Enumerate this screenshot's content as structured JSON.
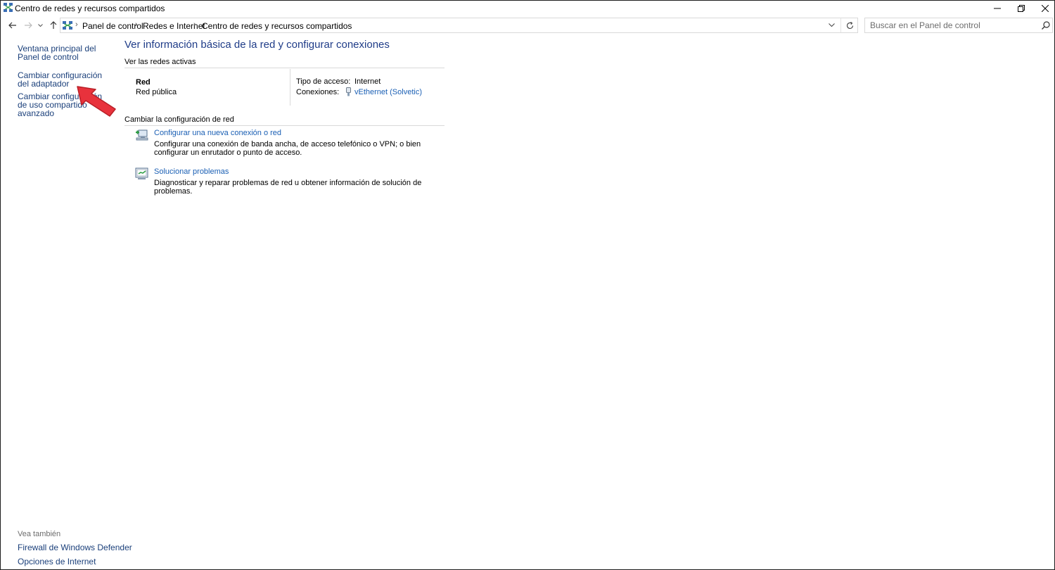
{
  "window": {
    "title": "Centro de redes y recursos compartidos",
    "icons": {
      "app": "network-center-icon",
      "minimize": "minimize-icon",
      "maximize": "restore-icon",
      "close": "close-icon"
    }
  },
  "navigation": {
    "breadcrumb": [
      "Panel de control",
      "Redes e Internet",
      "Centro de redes y recursos compartidos"
    ],
    "search_placeholder": "Buscar en el Panel de control"
  },
  "sidebar": {
    "links": [
      {
        "label": "Ventana principal del Panel de control"
      },
      {
        "label": "Cambiar configuración del adaptador"
      },
      {
        "label": "Cambiar configuración de uso compartido avanzado"
      }
    ],
    "see_also_label": "Vea también",
    "see_also_links": [
      {
        "label": "Firewall de Windows Defender"
      },
      {
        "label": "Opciones de Internet"
      }
    ]
  },
  "main": {
    "title": "Ver información básica de la red y configurar conexiones",
    "active_networks_heading": "Ver las redes activas",
    "network": {
      "name": "Red",
      "type": "Red pública",
      "access_type_label": "Tipo de acceso:",
      "access_type_value": "Internet",
      "connections_label": "Conexiones:",
      "connection_name": "vEthernet (Solvetic)"
    },
    "change_settings_heading": "Cambiar la configuración de red",
    "tasks": [
      {
        "link": "Configurar una nueva conexión o red",
        "description": "Configurar una conexión de banda ancha, de acceso telefónico o VPN; o bien configurar un enrutador o punto de acceso.",
        "icon": "new-connection-icon"
      },
      {
        "link": "Solucionar problemas",
        "description": "Diagnosticar y reparar problemas de red u obtener información de solución de problemas.",
        "icon": "troubleshoot-icon"
      }
    ]
  },
  "colors": {
    "link": "#1a5fb4",
    "nav_link": "#1a3f7a",
    "title": "#1f3c88",
    "annotation_arrow": "#e8323c"
  }
}
